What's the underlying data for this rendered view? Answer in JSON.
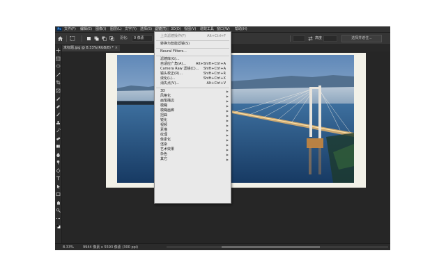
{
  "app": {
    "menus": [
      "文件(F)",
      "编辑(E)",
      "图像(I)",
      "图层(L)",
      "文字(Y)",
      "选择(S)",
      "滤镜(T)",
      "3D(D)",
      "视图(V)",
      "增效工具",
      "窗口(W)",
      "帮助(H)"
    ],
    "active_menu_index": 6,
    "logo": "Ps"
  },
  "options_bar": {
    "feather_label": "羽化:",
    "feather_value": "0 像素",
    "width_label": "宽度",
    "height_label": "高度",
    "select_mask_button": "选择并遮住..."
  },
  "document_tab": {
    "title": "未标题.jpg @ 8.33%(RGB/8) *",
    "close": "×"
  },
  "status_bar": {
    "zoom": "8.33%",
    "info": "9944 像素 x 5593 像素 (300 ppi)",
    "scroll_position_fraction": 0.5
  },
  "filter_menu": {
    "items": [
      {
        "label": "上次滤镜操作(F)",
        "shortcut": "Alt+Ctrl+F",
        "dim": true
      },
      {
        "divider": true
      },
      {
        "label": "转换为智能滤镜(S)",
        "dim": false
      },
      {
        "divider": true
      },
      {
        "label": "Neural Filters...",
        "dim": false
      },
      {
        "divider": true
      },
      {
        "label": "滤镜库(G)...",
        "dim": false
      },
      {
        "label": "自适应广角(A)...",
        "shortcut": "Alt+Shift+Ctrl+A",
        "dim": false
      },
      {
        "label": "Camera Raw 滤镜(C)...",
        "shortcut": "Shift+Ctrl+A",
        "dim": false
      },
      {
        "label": "镜头校正(R)...",
        "shortcut": "Shift+Ctrl+R",
        "dim": false
      },
      {
        "label": "液化(L)...",
        "shortcut": "Shift+Ctrl+X",
        "dim": false
      },
      {
        "label": "消失点(V)...",
        "shortcut": "Alt+Ctrl+V",
        "dim": false
      },
      {
        "divider": true
      },
      {
        "label": "3D",
        "submenu": true,
        "dim": false
      },
      {
        "label": "风格化",
        "submenu": true,
        "dim": false
      },
      {
        "label": "画笔描边",
        "submenu": true,
        "dim": false
      },
      {
        "label": "模糊",
        "submenu": true,
        "dim": false
      },
      {
        "label": "模糊画廊",
        "submenu": true,
        "dim": false
      },
      {
        "label": "扭曲",
        "submenu": true,
        "dim": false
      },
      {
        "label": "锐化",
        "submenu": true,
        "dim": false
      },
      {
        "label": "视频",
        "submenu": true,
        "dim": false
      },
      {
        "label": "素描",
        "submenu": true,
        "dim": false
      },
      {
        "label": "纹理",
        "submenu": true,
        "dim": false
      },
      {
        "label": "像素化",
        "submenu": true,
        "dim": false
      },
      {
        "label": "渲染",
        "submenu": true,
        "dim": false
      },
      {
        "label": "艺术效果",
        "submenu": true,
        "dim": false
      },
      {
        "label": "杂色",
        "submenu": true,
        "dim": false
      },
      {
        "label": "其它",
        "submenu": true,
        "dim": false
      }
    ]
  },
  "tools": [
    "move-icon",
    "marquee-icon",
    "lasso-icon",
    "magic-wand-icon",
    "crop-icon",
    "frame-icon",
    "eyedropper-icon",
    "healing-brush-icon",
    "brush-icon",
    "clone-stamp-icon",
    "history-brush-icon",
    "eraser-icon",
    "gradient-icon",
    "blur-icon",
    "dodge-icon",
    "pen-icon",
    "type-icon",
    "path-selection-icon",
    "rectangle-icon",
    "hand-icon",
    "zoom-icon",
    "more-tools-icon",
    "color-swatch-icon"
  ],
  "colors": {
    "app_bg": "#262626",
    "menubar_bg": "#323232",
    "dropdown_bg": "#e9e9e9",
    "doc_bg": "#f2f1e8",
    "accent": "#4aa3ff"
  }
}
